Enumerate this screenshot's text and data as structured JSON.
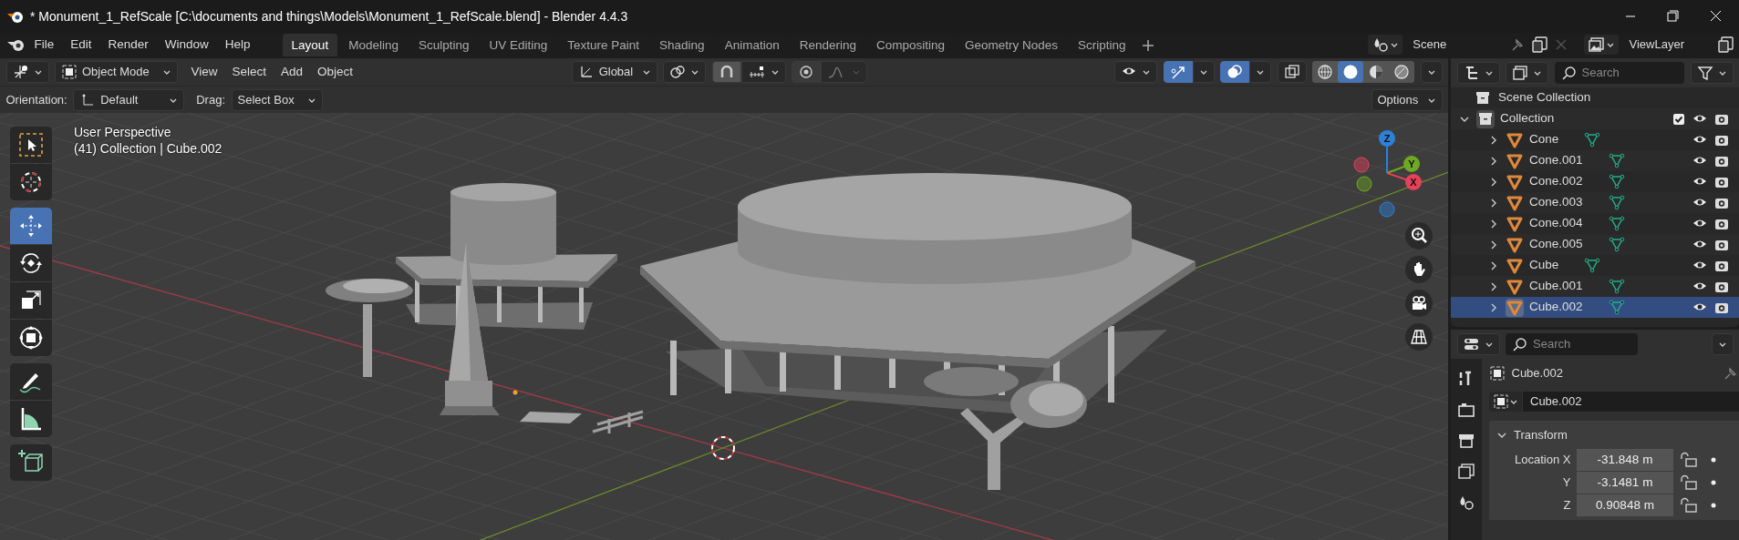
{
  "window": {
    "title": "* Monument_1_RefScale [C:\\documents and things\\Models\\Monument_1_RefScale.blend] - Blender 4.4.3"
  },
  "menu": [
    "File",
    "Edit",
    "Render",
    "Window",
    "Help"
  ],
  "workspaces": [
    {
      "label": "Layout",
      "selected": true
    },
    {
      "label": "Modeling",
      "selected": false
    },
    {
      "label": "Sculpting",
      "selected": false
    },
    {
      "label": "UV Editing",
      "selected": false
    },
    {
      "label": "Texture Paint",
      "selected": false
    },
    {
      "label": "Shading",
      "selected": false
    },
    {
      "label": "Animation",
      "selected": false
    },
    {
      "label": "Rendering",
      "selected": false
    },
    {
      "label": "Compositing",
      "selected": false
    },
    {
      "label": "Geometry Nodes",
      "selected": false
    },
    {
      "label": "Scripting",
      "selected": false
    }
  ],
  "scene": {
    "name": "Scene"
  },
  "view_layer": {
    "name": "ViewLayer"
  },
  "viewport_header": {
    "mode": "Object Mode",
    "menus": [
      "View",
      "Select",
      "Add",
      "Object"
    ],
    "orientation": "Global",
    "snap_on": false,
    "proportional_on": false,
    "gizmos_on": true,
    "overlays_on": true,
    "xray_on": false,
    "shading": [
      {
        "kind": "wireframe",
        "selected": false
      },
      {
        "kind": "solid",
        "selected": true
      },
      {
        "kind": "material",
        "selected": false
      },
      {
        "kind": "rendered",
        "selected": false
      }
    ]
  },
  "tool_settings": {
    "orientation_label": "Orientation:",
    "orientation": "Default",
    "drag_label": "Drag:",
    "drag": "Select Box",
    "options": "Options"
  },
  "viewport": {
    "view_name": "User Perspective",
    "context": "(41) Collection | Cube.002"
  },
  "toolbar": [
    {
      "kind": "select",
      "selected": false
    },
    {
      "kind": "cursor",
      "selected": false
    },
    {
      "kind": "move",
      "selected": true
    },
    {
      "kind": "rotate",
      "selected": false
    },
    {
      "kind": "scale",
      "selected": false
    },
    {
      "kind": "transform",
      "selected": false
    },
    {
      "kind": "annotate",
      "selected": false
    },
    {
      "kind": "measure",
      "selected": false
    },
    {
      "kind": "add-cube",
      "selected": false
    }
  ],
  "gizmo": {
    "axes": [
      {
        "label": "Z",
        "color": "#2e80d9"
      },
      {
        "label": "Y",
        "color": "#6fa823"
      },
      {
        "label": "X",
        "color": "#e6415a"
      }
    ]
  },
  "outliner": {
    "search_placeholder": "Search",
    "root": "Scene Collection",
    "collection": {
      "name": "Collection",
      "expanded": true,
      "checked": true,
      "children": [
        {
          "name": "Cone",
          "selected": false
        },
        {
          "name": "Cone.001",
          "selected": false
        },
        {
          "name": "Cone.002",
          "selected": false
        },
        {
          "name": "Cone.003",
          "selected": false
        },
        {
          "name": "Cone.004",
          "selected": false
        },
        {
          "name": "Cone.005",
          "selected": false
        },
        {
          "name": "Cube",
          "selected": false
        },
        {
          "name": "Cube.001",
          "selected": false
        },
        {
          "name": "Cube.002",
          "selected": true
        }
      ]
    }
  },
  "properties": {
    "search_placeholder": "Search",
    "object_name": "Cube.002",
    "datablock": "Cube.002",
    "panel": {
      "title": "Transform",
      "expanded": true,
      "fields": [
        {
          "label": "Location X",
          "value": "-31.848 m",
          "locked": false
        },
        {
          "label": "Y",
          "value": "-3.1481 m",
          "locked": false
        },
        {
          "label": "Z",
          "value": "0.90848 m",
          "locked": false
        }
      ]
    }
  }
}
